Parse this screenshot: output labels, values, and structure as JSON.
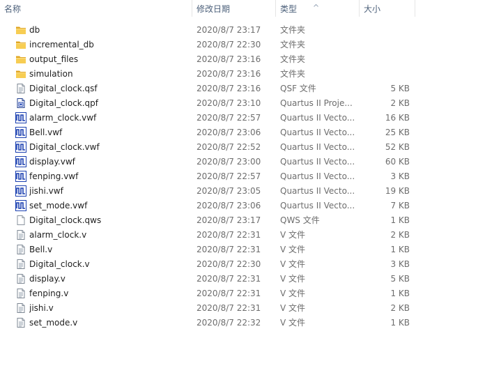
{
  "columns": {
    "name": "名称",
    "modified": "修改日期",
    "type": "类型",
    "size": "大小"
  },
  "sort": {
    "column": "type",
    "direction": "ascending",
    "indicator_icon": "sort-up-icon"
  },
  "files": [
    {
      "name": "db",
      "modified": "2020/8/7 23:17",
      "type": "文件夹",
      "size": "",
      "icon": "folder-icon"
    },
    {
      "name": "incremental_db",
      "modified": "2020/8/7 22:30",
      "type": "文件夹",
      "size": "",
      "icon": "folder-icon"
    },
    {
      "name": "output_files",
      "modified": "2020/8/7 23:16",
      "type": "文件夹",
      "size": "",
      "icon": "folder-icon"
    },
    {
      "name": "simulation",
      "modified": "2020/8/7 23:16",
      "type": "文件夹",
      "size": "",
      "icon": "folder-icon"
    },
    {
      "name": "Digital_clock.qsf",
      "modified": "2020/8/7 23:16",
      "type": "QSF 文件",
      "size": "5 KB",
      "icon": "text-file-icon"
    },
    {
      "name": "Digital_clock.qpf",
      "modified": "2020/8/7 23:10",
      "type": "Quartus II Proje...",
      "size": "2 KB",
      "icon": "quartus-project-icon"
    },
    {
      "name": "alarm_clock.vwf",
      "modified": "2020/8/7 22:57",
      "type": "Quartus II Vecto...",
      "size": "16 KB",
      "icon": "waveform-icon"
    },
    {
      "name": "Bell.vwf",
      "modified": "2020/8/7 23:06",
      "type": "Quartus II Vecto...",
      "size": "25 KB",
      "icon": "waveform-icon"
    },
    {
      "name": "Digital_clock.vwf",
      "modified": "2020/8/7 22:52",
      "type": "Quartus II Vecto...",
      "size": "52 KB",
      "icon": "waveform-icon"
    },
    {
      "name": "display.vwf",
      "modified": "2020/8/7 23:00",
      "type": "Quartus II Vecto...",
      "size": "60 KB",
      "icon": "waveform-icon"
    },
    {
      "name": "fenping.vwf",
      "modified": "2020/8/7 22:57",
      "type": "Quartus II Vecto...",
      "size": "3 KB",
      "icon": "waveform-icon"
    },
    {
      "name": "jishi.vwf",
      "modified": "2020/8/7 23:05",
      "type": "Quartus II Vecto...",
      "size": "19 KB",
      "icon": "waveform-icon"
    },
    {
      "name": "set_mode.vwf",
      "modified": "2020/8/7 23:06",
      "type": "Quartus II Vecto...",
      "size": "7 KB",
      "icon": "waveform-icon"
    },
    {
      "name": "Digital_clock.qws",
      "modified": "2020/8/7 23:17",
      "type": "QWS 文件",
      "size": "1 KB",
      "icon": "blank-file-icon"
    },
    {
      "name": "alarm_clock.v",
      "modified": "2020/8/7 22:31",
      "type": "V 文件",
      "size": "2 KB",
      "icon": "text-file-icon"
    },
    {
      "name": "Bell.v",
      "modified": "2020/8/7 22:31",
      "type": "V 文件",
      "size": "1 KB",
      "icon": "text-file-icon"
    },
    {
      "name": "Digital_clock.v",
      "modified": "2020/8/7 22:30",
      "type": "V 文件",
      "size": "3 KB",
      "icon": "text-file-icon"
    },
    {
      "name": "display.v",
      "modified": "2020/8/7 22:31",
      "type": "V 文件",
      "size": "5 KB",
      "icon": "text-file-icon"
    },
    {
      "name": "fenping.v",
      "modified": "2020/8/7 22:31",
      "type": "V 文件",
      "size": "1 KB",
      "icon": "text-file-icon"
    },
    {
      "name": "jishi.v",
      "modified": "2020/8/7 22:31",
      "type": "V 文件",
      "size": "2 KB",
      "icon": "text-file-icon"
    },
    {
      "name": "set_mode.v",
      "modified": "2020/8/7 22:32",
      "type": "V 文件",
      "size": "1 KB",
      "icon": "text-file-icon"
    }
  ],
  "colors": {
    "header_text": "#4c607a",
    "name_text": "#1e1e1e",
    "meta_text": "#6d6d6d",
    "folder": "#f5c342",
    "waveform_blue": "#1a3fb0"
  }
}
